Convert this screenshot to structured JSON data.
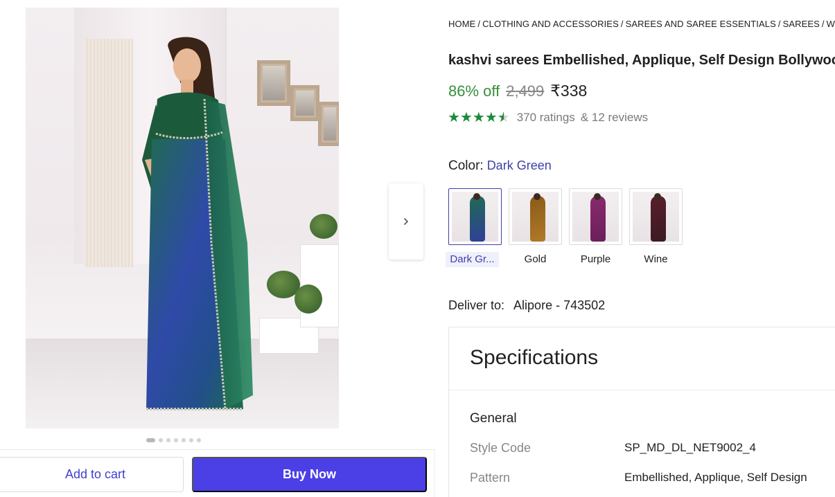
{
  "gallery": {
    "dots_count": 7,
    "active_dot": 0,
    "next_icon": "chevron-right-icon"
  },
  "actions": {
    "add_to_cart": "Add to cart",
    "buy_now": "Buy Now"
  },
  "breadcrumb": [
    "HOME",
    "CLOTHING AND ACCESSORIES",
    "SAREES AND SAREE ESSENTIALS",
    "SAREES",
    "WOMEN"
  ],
  "product": {
    "title": "kashvi sarees Embellished, Applique, Self Design Bollywood",
    "discount": "86% off",
    "mrp": "2,499",
    "price": "₹338",
    "rating_value": 4.3,
    "ratings_text": "370 ratings",
    "reviews_text": "& 12 reviews"
  },
  "color": {
    "label": "Color:",
    "selected": "Dark Green",
    "options": [
      {
        "name": "Dark Gr...",
        "swatch": "#1f6b52",
        "accent": "#2f3f9a"
      },
      {
        "name": "Gold",
        "swatch": "#8a5a18",
        "accent": "#b07a2a"
      },
      {
        "name": "Purple",
        "swatch": "#8a2a6e",
        "accent": "#6a1f5a"
      },
      {
        "name": "Wine",
        "swatch": "#5a1f2a",
        "accent": "#3a1a24"
      }
    ]
  },
  "delivery": {
    "label": "Deliver to:",
    "location": "Alipore - 743502"
  },
  "specifications": {
    "title": "Specifications",
    "group": "General",
    "rows": [
      {
        "key": "Style Code",
        "value": "SP_MD_DL_NET9002_4"
      },
      {
        "key": "Pattern",
        "value": "Embellished, Applique, Self Design"
      }
    ]
  },
  "colors": {
    "accent": "#4b3fe6",
    "discount_green": "#388e3c",
    "star_green": "#1b8a3a",
    "link_blue": "#3f3fa8"
  }
}
